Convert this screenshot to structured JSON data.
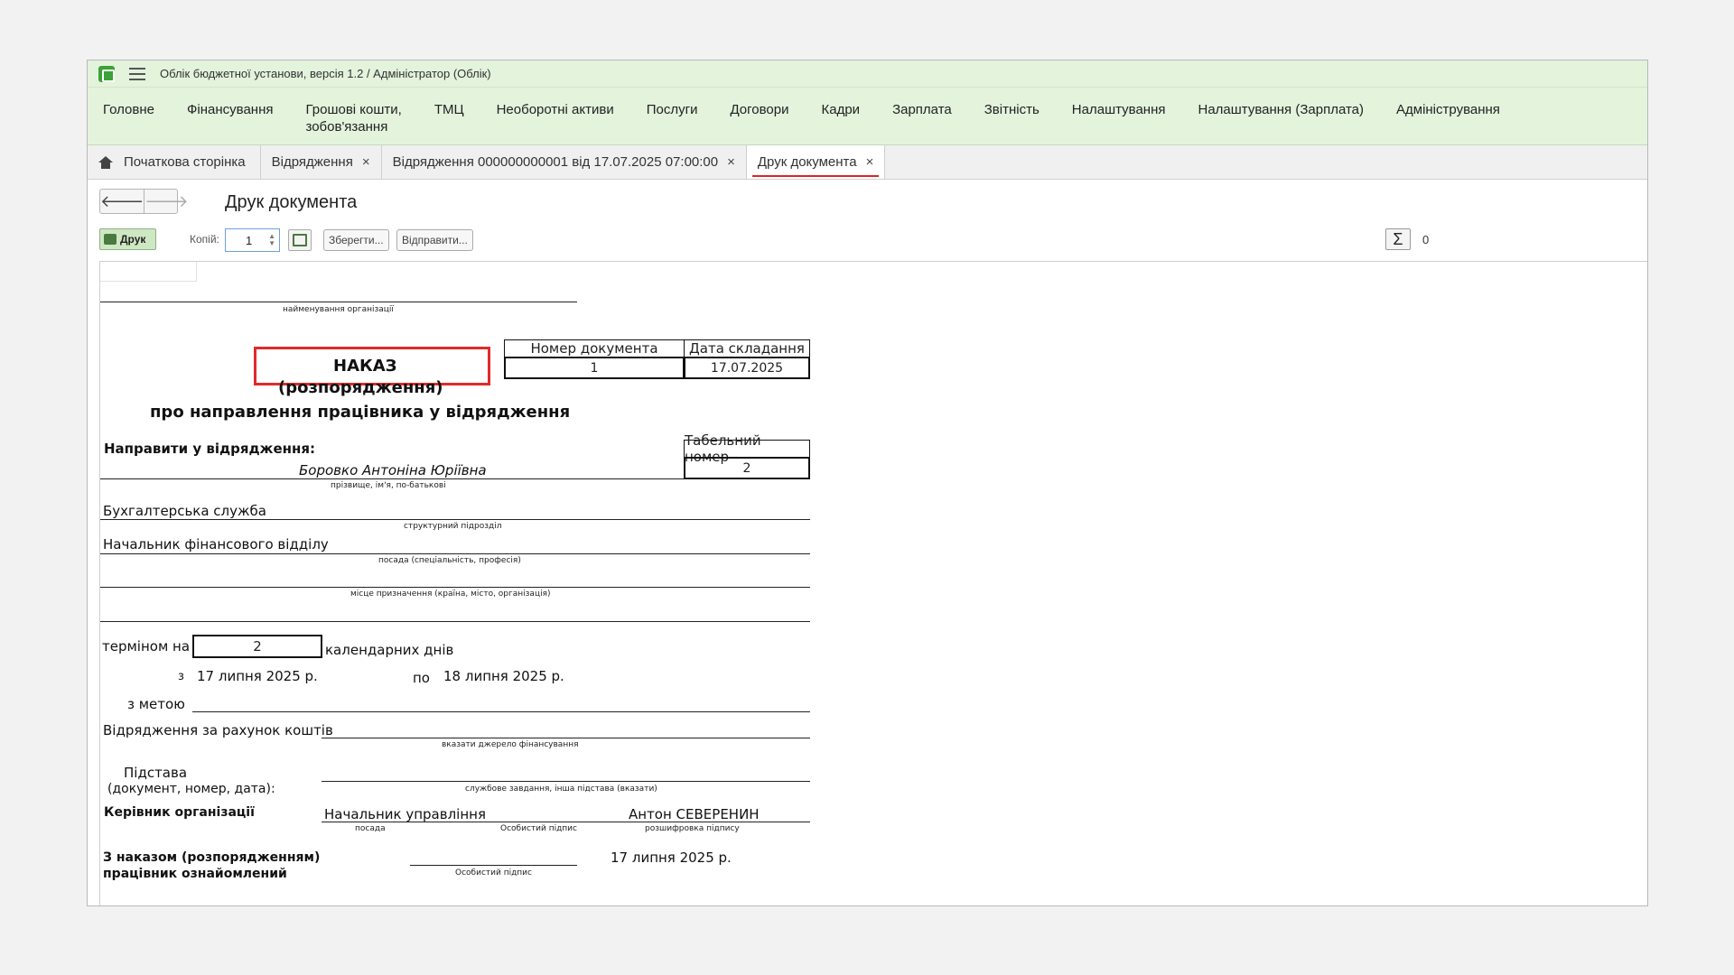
{
  "app": {
    "title": "Облік бюджетної установи, версія 1.2 / Адміністратор  (Облік)"
  },
  "menu": [
    {
      "label": "Головне"
    },
    {
      "label": "Фінансування"
    },
    {
      "label": "Грошові кошти,\nзобов'язання"
    },
    {
      "label": "ТМЦ"
    },
    {
      "label": "Необоротні активи"
    },
    {
      "label": "Послуги"
    },
    {
      "label": "Договори"
    },
    {
      "label": "Кадри"
    },
    {
      "label": "Зарплата"
    },
    {
      "label": "Звітність"
    },
    {
      "label": "Налаштування"
    },
    {
      "label": "Налаштування (Зарплата)"
    },
    {
      "label": "Адміністрування"
    }
  ],
  "tabs": [
    {
      "label": "Початкова сторінка"
    },
    {
      "label": "Відрядження",
      "close": "×"
    },
    {
      "label": "Відрядження 000000000001 від 17.07.2025 07:00:00",
      "close": "×"
    },
    {
      "label": "Друк документа",
      "close": "×"
    }
  ],
  "header": {
    "title": "Друк документа"
  },
  "toolbar": {
    "print_label": "Друк",
    "copies_label": "Копій:",
    "copies_value": "1",
    "save_label": "Зберегти...",
    "send_label": "Відправити...",
    "sum_symbol": "Σ",
    "sum_value": "0"
  },
  "document": {
    "org_caption": "найменування організації",
    "num_header": "Номер документа",
    "date_header": "Дата складання",
    "doc_number": "1",
    "doc_date": "17.07.2025",
    "title": "НАКАЗ",
    "subtitle": "(розпорядження)",
    "subtitle2": "про направлення працівника у відрядження",
    "send_label": "Направити у відрядження:",
    "tab_header": "Табельний номер",
    "tab_number": "2",
    "employee": "Боровко Антоніна Юріївна",
    "employee_caption": "прізвище, ім'я, по-батькові",
    "department": "Бухгалтерська служба",
    "department_caption": "структурний підрозділ",
    "position": "Начальник фінансового відділу",
    "position_caption": "посада (спеціальність, професія)",
    "destination_caption": "місце призначення (країна, місто, організація)",
    "term_label": "терміном на",
    "term_days": "2",
    "term_unit": "календарних днів",
    "from_label": "з",
    "from_date": "17 липня 2025 р.",
    "to_label": "по",
    "to_date": "18 липня 2025 р.",
    "purpose_label": "з метою",
    "funding_label": "Відрядження за рахунок коштів",
    "funding_caption": "вказати джерело фінансування",
    "basis_label": "Підстава",
    "basis_sub": "(документ, номер, дата):",
    "basis_caption": "службове завдання, інша підстава (вказати)",
    "head_label": "Керівник організації",
    "head_position": "Начальник управління",
    "head_name": "Антон СЕВЕРЕНИН",
    "pos_caption": "посада",
    "sign_caption": "Особистий підпис",
    "decode_caption": "розшифровка підпису",
    "ack_label1": "З наказом (розпорядженням)",
    "ack_label2": "працівник ознайомлений",
    "ack_date": "17 липня 2025 р.",
    "ack_sign_caption": "Особистий підпис"
  }
}
